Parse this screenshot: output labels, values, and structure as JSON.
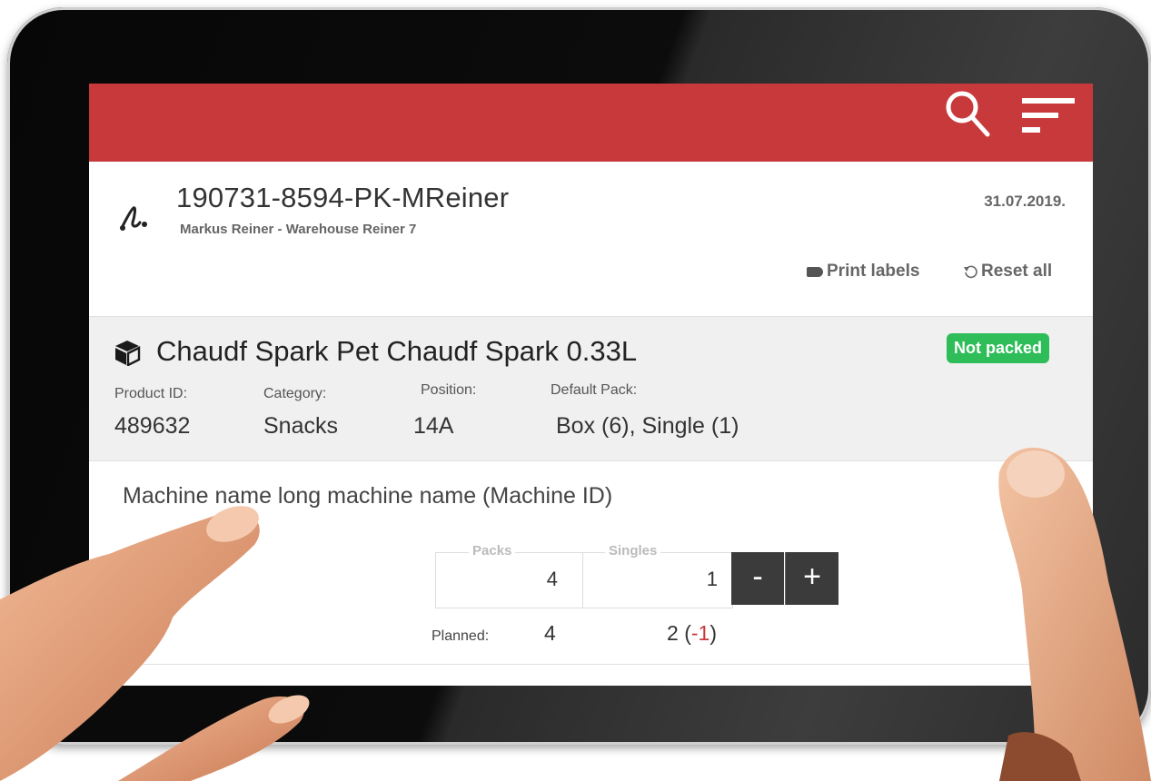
{
  "order": {
    "id": "190731-8594-PK-MReiner",
    "subtitle": "Markus Reiner - Warehouse Reiner 7",
    "date": "31.07.2019."
  },
  "actions": {
    "print_labels": "Print labels",
    "reset_all": "Reset all"
  },
  "product": {
    "name": "Chaudf Spark Pet Chaudf Spark 0.33L",
    "status": "Not packed",
    "product_id_label": "Product ID:",
    "product_id": "489632",
    "category_label": "Category:",
    "category": "Snacks",
    "position_label": "Position:",
    "position": "14A",
    "default_pack_label": "Default Pack:",
    "default_pack": "Box (6), Single (1)"
  },
  "machine": {
    "name": "Machine name long machine name (Machine ID)"
  },
  "quantities": {
    "packs_label": "Packs",
    "packs_value": "4",
    "singles_label": "Singles",
    "singles_value": "1",
    "minus": "-",
    "plus": "+",
    "planned_label": "Planned:",
    "planned_packs": "4",
    "planned_singles": "2",
    "planned_open": "(",
    "planned_diff": "-1",
    "planned_close": ")"
  },
  "colors": {
    "brand_red": "#c8393c",
    "status_green": "#2ebd59",
    "stepper_dark": "#3b3b3b"
  },
  "icons": [
    "search-icon",
    "menu-icon",
    "signature-icon",
    "label-icon",
    "reset-icon",
    "box-icon"
  ]
}
